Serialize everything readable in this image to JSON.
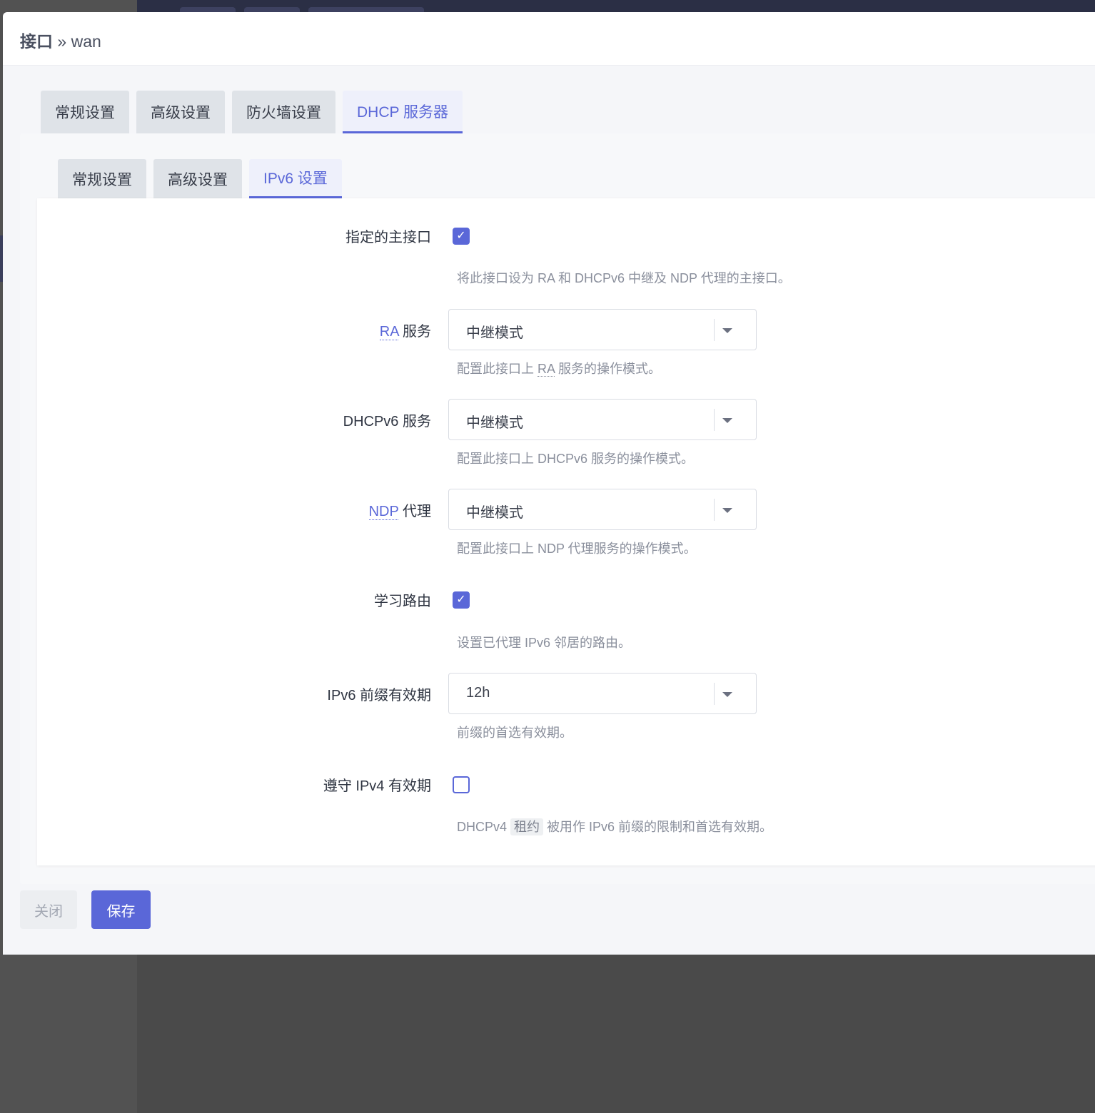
{
  "modal": {
    "title_prefix": "接口",
    "title_sep": " » ",
    "title_name": "wan"
  },
  "outer_tabs": [
    "常规设置",
    "高级设置",
    "防火墙设置",
    "DHCP 服务器"
  ],
  "inner_tabs": [
    "常规设置",
    "高级设置",
    "IPv6 设置"
  ],
  "fields": {
    "master": {
      "label": "指定的主接口",
      "checked": true,
      "description": "将此接口设为 RA 和 DHCPv6 中继及 NDP 代理的主接口。"
    },
    "ra": {
      "label_abbr": "RA",
      "label_rest": " 服务",
      "value": "中继模式",
      "desc_prefix": "配置此接口上 ",
      "desc_abbr": "RA",
      "desc_suffix": " 服务的操作模式。"
    },
    "dhcpv6": {
      "label": "DHCPv6 服务",
      "value": "中继模式",
      "description": "配置此接口上 DHCPv6 服务的操作模式。"
    },
    "ndp": {
      "label_abbr": "NDP",
      "label_rest": " 代理",
      "value": "中继模式",
      "description": "配置此接口上 NDP 代理服务的操作模式。"
    },
    "learn_routes": {
      "label": "学习路由",
      "checked": true,
      "description": "设置已代理 IPv6 邻居的路由。"
    },
    "prefix_lifetime": {
      "label": "IPv6 前缀有效期",
      "value": "12h",
      "description": "前缀的首选有效期。"
    },
    "ipv4_lifetime": {
      "label": "遵守 IPv4 有效期",
      "checked": false,
      "desc_prefix": "DHCPv4 ",
      "desc_code": "租约",
      "desc_suffix": " 被用作 IPv6 前缀的限制和首选有效期。"
    }
  },
  "footer": {
    "close_label": "关闭",
    "save_label": "保存"
  },
  "colors": {
    "accent": "#5a67d8",
    "overlay": "#4a4a4a",
    "topbar": "#2b2f45"
  }
}
